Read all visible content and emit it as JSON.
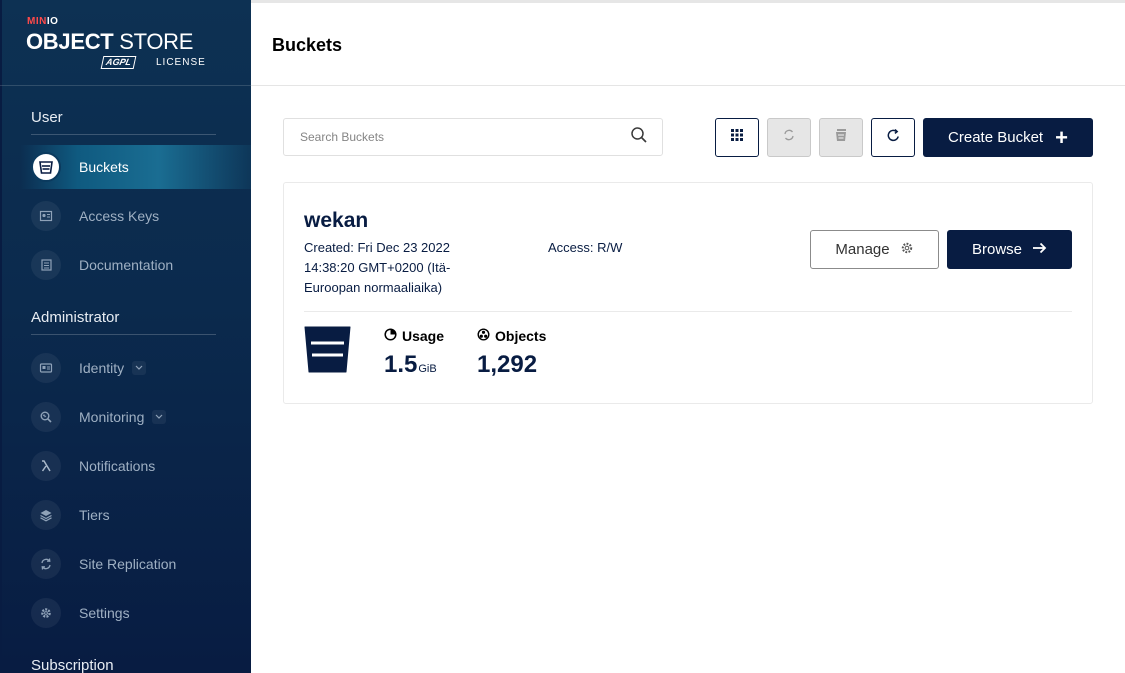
{
  "logo": {
    "brand_a": "MIN",
    "brand_b": "IO",
    "product_bold": "OBJECT",
    "product_rest": " STORE",
    "agpl": "AGPL",
    "license": "LICENSE"
  },
  "sidebar": {
    "user_section": "User",
    "admin_section": "Administrator",
    "subscription_section": "Subscription",
    "user_items": [
      {
        "label": "Buckets",
        "icon": "bucket-icon",
        "active": true
      },
      {
        "label": "Access Keys",
        "icon": "key-card-icon"
      },
      {
        "label": "Documentation",
        "icon": "document-icon"
      }
    ],
    "admin_items": [
      {
        "label": "Identity",
        "icon": "id-card-icon",
        "expandable": true
      },
      {
        "label": "Monitoring",
        "icon": "magnifier-icon",
        "expandable": true
      },
      {
        "label": "Notifications",
        "icon": "lambda-icon"
      },
      {
        "label": "Tiers",
        "icon": "layers-icon"
      },
      {
        "label": "Site Replication",
        "icon": "replication-icon"
      },
      {
        "label": "Settings",
        "icon": "gear-icon"
      }
    ]
  },
  "header": {
    "title": "Buckets"
  },
  "toolbar": {
    "search_placeholder": "Search Buckets",
    "create_label": "Create Bucket",
    "create_icon": "+"
  },
  "bucket": {
    "name": "wekan",
    "created": "Created: Fri Dec 23 2022 14:38:20 GMT+0200 (Itä-Euroopan normaaliaika)",
    "access": "Access: R/W",
    "manage_label": "Manage",
    "browse_label": "Browse",
    "usage_label": "Usage",
    "usage_value": "1.5",
    "usage_unit": "GiB",
    "objects_label": "Objects",
    "objects_value": "1,292"
  },
  "colors": {
    "primary": "#081c42",
    "sidebar_top": "#0d3153",
    "active_item": "#1a6d92",
    "brand_red": "#ff4a4a"
  }
}
